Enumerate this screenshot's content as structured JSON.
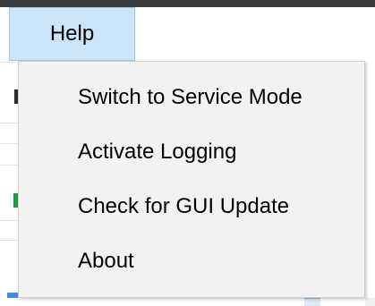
{
  "menu_bar": {
    "help_label": "Help"
  },
  "help_menu": {
    "items": [
      {
        "label": "Switch to Service Mode"
      },
      {
        "label": "Activate Logging"
      },
      {
        "label": "Check for GUI Update"
      },
      {
        "label": "About"
      }
    ]
  },
  "colors": {
    "top_bar": "#3c3c3c",
    "menu_highlight": "#cce4f7",
    "menu_highlight_border": "#99c9ef",
    "dropdown_background": "#f2f2f2",
    "dropdown_border": "#cccccc"
  }
}
